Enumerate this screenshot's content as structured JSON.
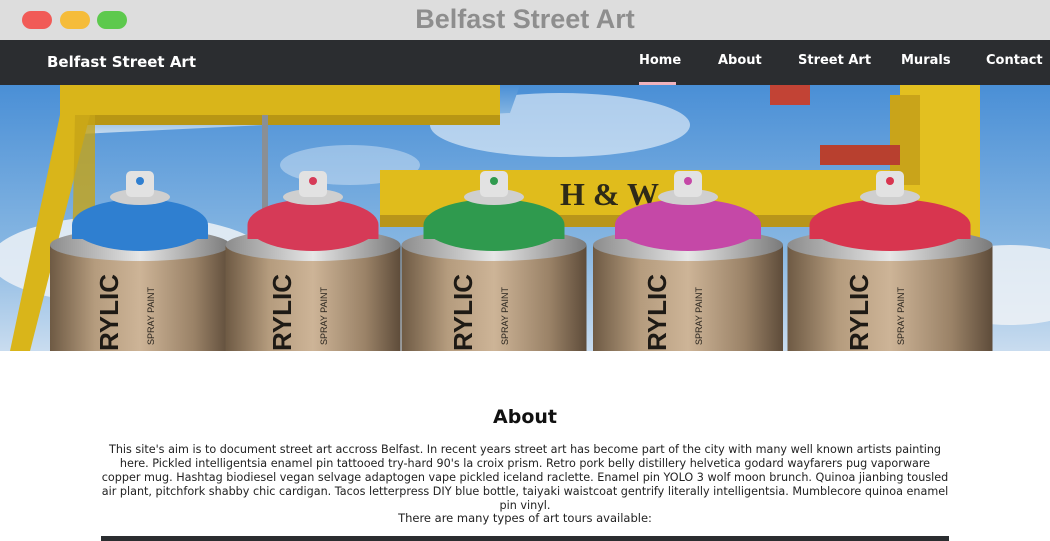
{
  "window": {
    "title": "Belfast Street Art"
  },
  "navbar": {
    "brand": "Belfast Street Art",
    "links": [
      {
        "label": "Home",
        "active": true
      },
      {
        "label": "About",
        "active": false
      },
      {
        "label": "Street Art",
        "active": false
      },
      {
        "label": "Murals",
        "active": false
      },
      {
        "label": "Contact",
        "active": false
      }
    ],
    "active_color": "#f0b3bd"
  },
  "hero": {
    "crane_text": "H & W",
    "can_label_main": "RYLIC",
    "can_label_side": "SPRAY PAINT",
    "cap_colors": [
      "#2f7fd0",
      "#d63a57",
      "#2f9a4e",
      "#c548a7",
      "#d8354f"
    ]
  },
  "about": {
    "heading": "About",
    "paragraph": "This site's aim is to document street art accross Belfast. In recent years street art has become part of the city with many well known artists painting here. Pickled intelligentsia enamel pin tattooed try-hard 90's la croix prism. Retro pork belly distillery helvetica godard wayfarers pug vaporware copper mug. Hashtag biodiesel vegan selvage adaptogen vape pickled iceland raclette. Enamel pin YOLO 3 wolf moon brunch. Quinoa jianbing tousled air plant, pitchfork shabby chic cardigan. Tacos letterpress DIY blue bottle, taiyaki waistcoat gentrify literally intelligentsia. Mumblecore quinoa enamel pin vinyl.",
    "tours_intro": "There are many types of art tours available:"
  },
  "colors": {
    "navbar_bg": "#2b2d30",
    "titlebar_bg": "#dddddd",
    "crane_yellow": "#e8c51c"
  }
}
